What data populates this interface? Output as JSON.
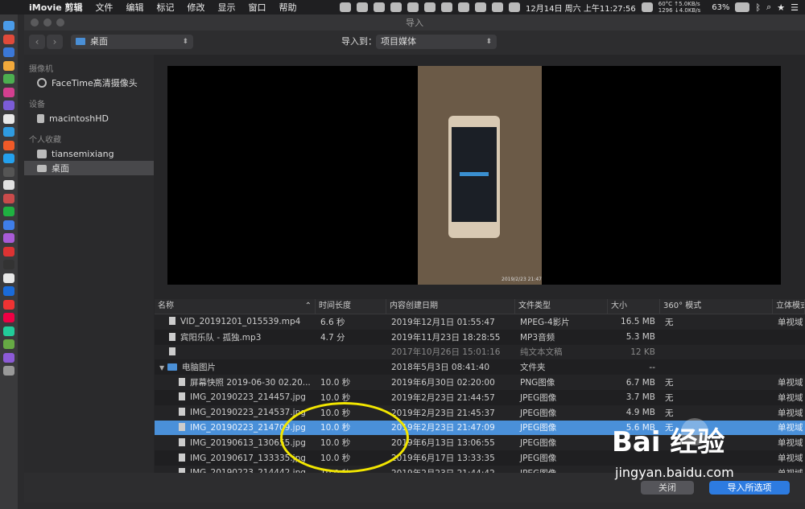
{
  "menubar": {
    "app": "iMovie 剪辑",
    "items": [
      "文件",
      "编辑",
      "标记",
      "修改",
      "显示",
      "窗口",
      "帮助"
    ],
    "temp": "60°C",
    "cpu": "1296",
    "up": "↑5.0KB/s",
    "down": "↓4.0KB/s",
    "battery": "63%",
    "datetime": "12月14日 周六 上午11:27:56"
  },
  "window": {
    "title": "导入",
    "location": "桌面",
    "import_to_label": "导入到：",
    "import_to_value": "项目媒体"
  },
  "sidebar": {
    "sections": [
      {
        "heading": "摄像机",
        "items": [
          {
            "label": "FaceTime高清摄像头",
            "icon": "camera-icon"
          }
        ]
      },
      {
        "heading": "设备",
        "items": [
          {
            "label": "macintoshHD",
            "icon": "disk-icon"
          }
        ]
      },
      {
        "heading": "个人收藏",
        "items": [
          {
            "label": "tiansemixiang",
            "icon": "home-icon"
          },
          {
            "label": "桌面",
            "icon": "desktop-icon",
            "selected": true
          }
        ]
      }
    ]
  },
  "preview": {
    "timestamp": "2019/2/23 21:47"
  },
  "table": {
    "headers": [
      "名称",
      "时间长度",
      "内容创建日期",
      "文件类型",
      "大小",
      "360° 模式",
      "立体模式"
    ],
    "rows": [
      {
        "name": "VID_20191201_015539.mp4",
        "dur": "6.6 秒",
        "date": "2019年12月1日 01:55:47",
        "type": "MPEG-4影片",
        "size": "16.5 MB",
        "m360": "无",
        "m3d": "单视域",
        "indent": 1
      },
      {
        "name": "宾阳乐队 - 孤独.mp3",
        "dur": "4.7 分",
        "date": "2019年11月23日 18:28:55",
        "type": "MP3音频",
        "size": "5.3 MB",
        "m360": "",
        "m3d": "",
        "indent": 1
      },
      {
        "name": "",
        "dur": "",
        "date": "2017年10月26日 15:01:16",
        "type": "纯文本文稿",
        "size": "12 KB",
        "m360": "",
        "m3d": "",
        "indent": 1,
        "dim": true
      },
      {
        "name": "电脑图片",
        "dur": "",
        "date": "2018年5月3日 08:41:40",
        "type": "文件夹",
        "size": "--",
        "m360": "",
        "m3d": "",
        "indent": 0,
        "folder": true
      },
      {
        "name": "屏幕快照 2019-06-30 02.20...",
        "dur": "10.0 秒",
        "date": "2019年6月30日 02:20:00",
        "type": "PNG图像",
        "size": "6.7 MB",
        "m360": "无",
        "m3d": "单视域",
        "indent": 2
      },
      {
        "name": "IMG_20190223_214457.jpg",
        "dur": "10.0 秒",
        "date": "2019年2月23日 21:44:57",
        "type": "JPEG图像",
        "size": "3.7 MB",
        "m360": "无",
        "m3d": "单视域",
        "indent": 2
      },
      {
        "name": "IMG_20190223_214537.jpg",
        "dur": "10.0 秒",
        "date": "2019年2月23日 21:45:37",
        "type": "JPEG图像",
        "size": "4.9 MB",
        "m360": "无",
        "m3d": "单视域",
        "indent": 2
      },
      {
        "name": "IMG_20190223_214709.jpg",
        "dur": "10.0 秒",
        "date": "2019年2月23日 21:47:09",
        "type": "JPEG图像",
        "size": "5.6 MB",
        "m360": "无",
        "m3d": "单视域",
        "indent": 2,
        "selected": true
      },
      {
        "name": "IMG_20190613_130655.jpg",
        "dur": "10.0 秒",
        "date": "2019年6月13日 13:06:55",
        "type": "JPEG图像",
        "size": "",
        "m360": "",
        "m3d": "单视域",
        "indent": 2
      },
      {
        "name": "IMG_20190617_133335.jpg",
        "dur": "10.0 秒",
        "date": "2019年6月17日 13:33:35",
        "type": "JPEG图像",
        "size": "",
        "m360": "",
        "m3d": "单视域",
        "indent": 2
      },
      {
        "name": "IMG_20190223_214442.jpg",
        "dur": "10.0 秒",
        "date": "2019年2月23日 21:44:42",
        "type": "JPEG图像",
        "size": "",
        "m360": "",
        "m3d": "单视域",
        "indent": 2
      }
    ]
  },
  "buttons": {
    "close": "关闭",
    "import": "导入所选项"
  },
  "watermark": {
    "brand": "Bai 经验",
    "url": "jingyan.baidu.com"
  },
  "colors": {
    "selection": "#4a90d9",
    "primary_button": "#2d7be0",
    "highlight_circle": "#f2e600"
  }
}
